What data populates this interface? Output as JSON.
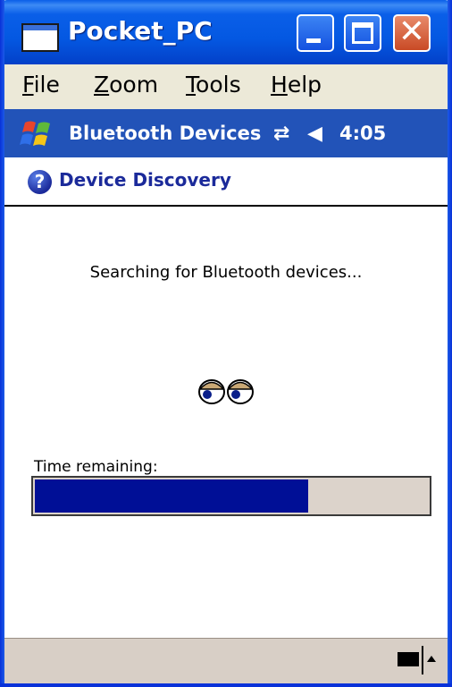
{
  "window": {
    "title": "Pocket_PC",
    "controls": [
      "minimize-icon",
      "maximize-icon",
      "close-icon"
    ],
    "close_glyph": "✕"
  },
  "menu": {
    "items": [
      {
        "label_ul": "F",
        "label_rest": "ile"
      },
      {
        "label_ul": "Z",
        "label_rest": "oom"
      },
      {
        "label_ul": "T",
        "label_rest": "ools"
      },
      {
        "label_ul": "H",
        "label_rest": "elp"
      }
    ]
  },
  "taskbar": {
    "title": "Bluetooth Devices",
    "connectivity_glyph": "⇄",
    "volume_glyph": "◀",
    "time": "4:05"
  },
  "section": {
    "title": "Device Discovery",
    "help_glyph": "?"
  },
  "main": {
    "message": "Searching for Bluetooth devices...",
    "time_remaining_label": "Time remaining:",
    "progress_fraction": 0.695
  },
  "colors": {
    "title_bar": "#0458e2",
    "taskbar": "#2253b8",
    "section_title": "#1b2a9a",
    "progress_fill": "#000f96",
    "progress_track": "#dcd3cb",
    "bottom_bar": "#d8cfc6"
  },
  "icons": {
    "app": "window-icon",
    "start": "windows-flag-icon",
    "section": "help-icon",
    "animation": "searching-eyes-icon",
    "input_panel": "keyboard-icon"
  }
}
